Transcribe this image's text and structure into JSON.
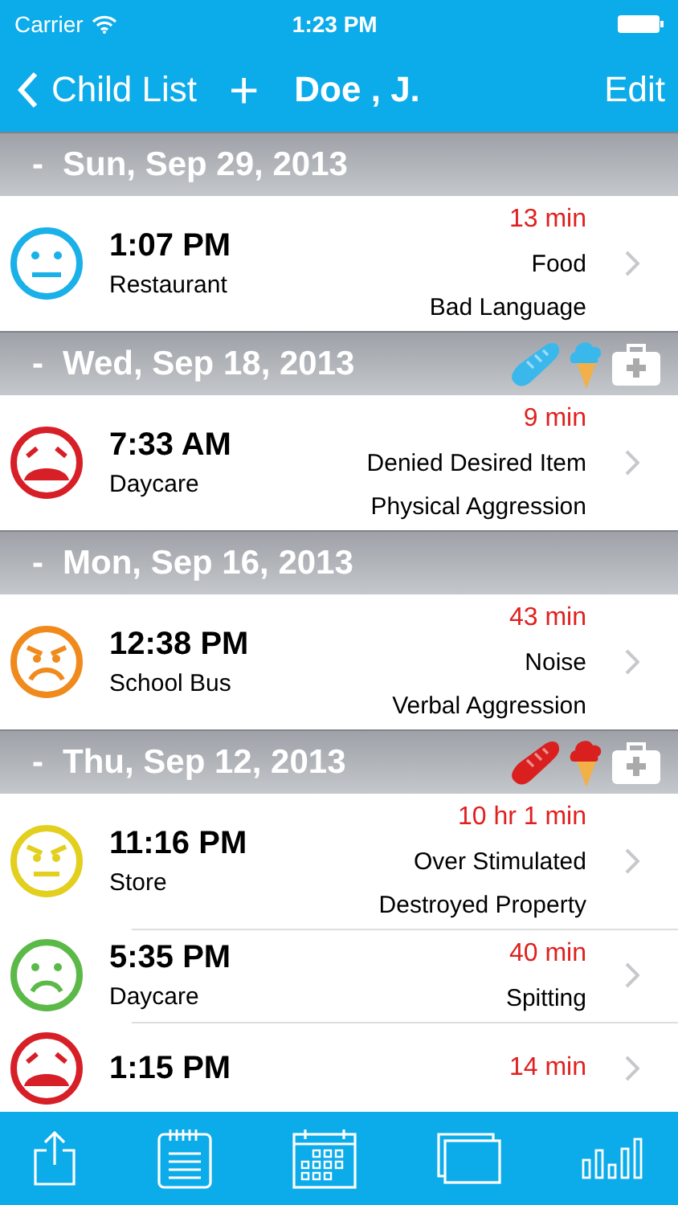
{
  "status_bar": {
    "carrier": "Carrier",
    "time": "1:23 PM"
  },
  "nav": {
    "back": "Child List",
    "add": "+",
    "title": "Doe , J.",
    "edit": "Edit"
  },
  "sections": [
    {
      "date": "Sun, Sep 29, 2013",
      "collapse": "-",
      "rows": [
        {
          "kind": "neutral",
          "color": "#1ab0e8",
          "time": "1:07 PM",
          "place": "Restaurant",
          "duration": "13 min",
          "trigger": "Food",
          "behavior": "Bad Language"
        }
      ]
    },
    {
      "date": "Wed, Sep 18, 2013",
      "collapse": "-",
      "markers": [
        {
          "kind": "bread",
          "color": "#3ab8ec"
        },
        {
          "kind": "icecream",
          "color": "#3ab8ec"
        },
        {
          "kind": "firstaid",
          "color": "#ffffff"
        }
      ],
      "rows": [
        {
          "kind": "crying",
          "color": "#d71f27",
          "time": "7:33 AM",
          "place": "Daycare",
          "duration": "9 min",
          "trigger": "Denied Desired Item",
          "behavior": "Physical Aggression"
        }
      ]
    },
    {
      "date": "Mon, Sep 16, 2013",
      "collapse": "-",
      "rows": [
        {
          "kind": "angry",
          "color": "#f08a1c",
          "time": "12:38 PM",
          "place": "School Bus",
          "duration": "43 min",
          "trigger": "Noise",
          "behavior": "Verbal Aggression"
        }
      ]
    },
    {
      "date": "Thu, Sep 12, 2013",
      "collapse": "-",
      "markers": [
        {
          "kind": "bread",
          "color": "#d9201f"
        },
        {
          "kind": "icecream",
          "color": "#d9201f"
        },
        {
          "kind": "firstaid",
          "color": "#ffffff"
        }
      ],
      "rows": [
        {
          "kind": "annoyed",
          "color": "#e2cf1e",
          "time": "11:16 PM",
          "place": "Store",
          "duration": "10 hr 1 min",
          "trigger": "Over Stimulated",
          "behavior": "Destroyed Property"
        },
        {
          "kind": "sad",
          "color": "#5bb948",
          "time": "5:35 PM",
          "place": "Daycare",
          "duration": "40 min",
          "trigger": "Spitting"
        },
        {
          "kind": "crying",
          "color": "#d71f27",
          "time": "1:15 PM",
          "duration": "14 min"
        }
      ]
    }
  ],
  "tab_bar": [
    {
      "kind": "share"
    },
    {
      "kind": "notes"
    },
    {
      "kind": "calendar"
    },
    {
      "kind": "windows"
    },
    {
      "kind": "chart"
    }
  ]
}
